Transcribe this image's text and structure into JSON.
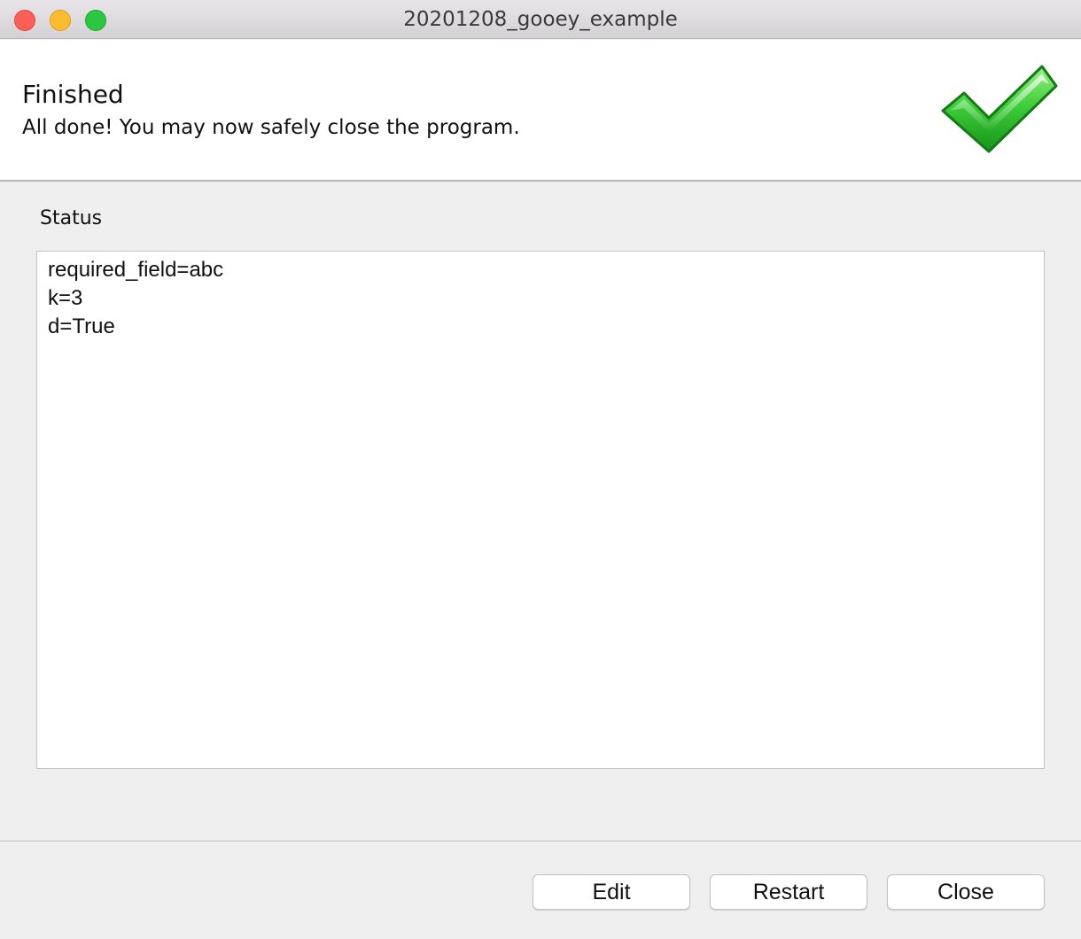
{
  "window": {
    "title": "20201208_gooey_example"
  },
  "header": {
    "title": "Finished",
    "subtitle": "All done! You may now safely close the program.",
    "icon": "green-checkmark-icon"
  },
  "status": {
    "label": "Status",
    "lines": [
      "required_field=abc",
      "k=3",
      "d=True"
    ]
  },
  "buttons": {
    "edit": "Edit",
    "restart": "Restart",
    "close": "Close"
  },
  "colors": {
    "close_light": "#fc5f57",
    "minimize_light": "#fdbb2e",
    "maximize_light": "#29c840",
    "check_green": "#2fb82f"
  }
}
